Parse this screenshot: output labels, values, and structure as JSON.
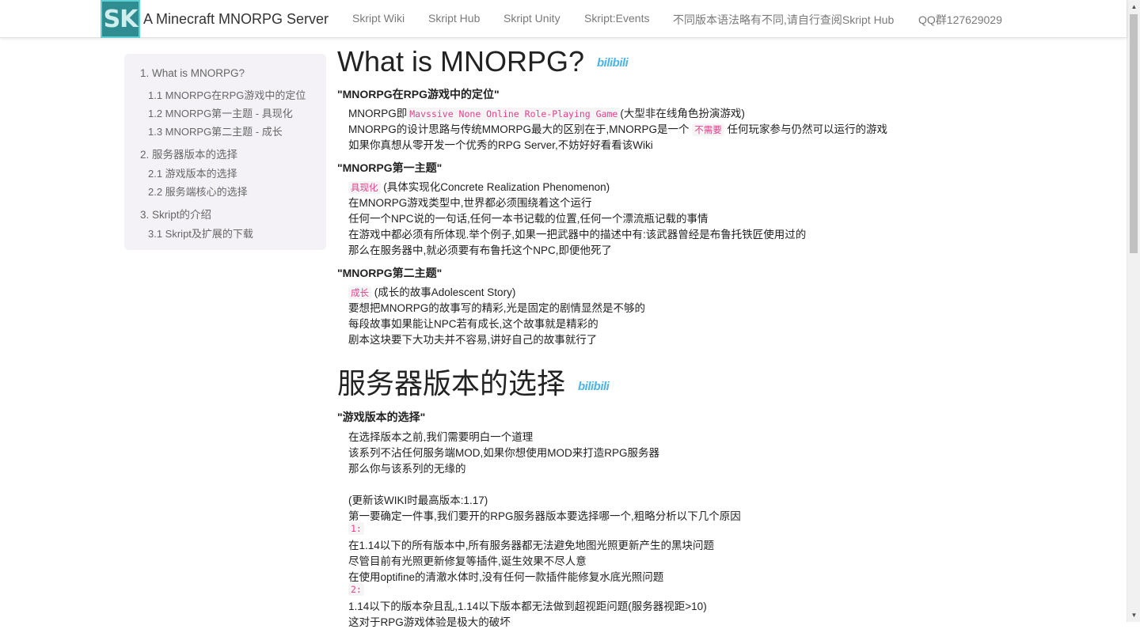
{
  "navbar": {
    "logo_text": "SK",
    "title": "A Minecraft MNORPG Server",
    "links": [
      "Skript Wiki",
      "Skript Hub",
      "Skript Unity",
      "Skript:Events",
      "不同版本语法略有不同,请自行查阅Skript Hub",
      "QQ群127629029"
    ]
  },
  "toc": {
    "items": [
      {
        "label": "1. What is MNORPG?"
      },
      {
        "label": "1.1 MNORPG在RPG游戏中的定位"
      },
      {
        "label": "1.2 MNORPG第一主题 - 具现化"
      },
      {
        "label": "1.3 MNORPG第二主题 - 成长"
      },
      {
        "label": "2. 服务器版本的选择"
      },
      {
        "label": "2.1 游戏版本的选择"
      },
      {
        "label": "2.2 服务端核心的选择"
      },
      {
        "label": "3. Skript的介绍"
      },
      {
        "label": "3.1 Skript及扩展的下载"
      }
    ]
  },
  "sections": {
    "s1": {
      "title": "What is MNORPG?",
      "bilibili": "bilibili",
      "sub1": {
        "heading": "\"MNORPG在RPG游戏中的定位\"",
        "l1_pre": "MNORPG即",
        "l1_code": "Mavssive None Online Role-Playing Game",
        "l1_post": "(大型非在线角色扮演游戏)",
        "l2_pre": "MNORPG的设计思路与传统MMORPG最大的区别在于,MNORPG是一个",
        "l2_code": "不需要",
        "l2_post": "任何玩家参与仍然可以运行的游戏",
        "l3": "如果你真想从零开发一个优秀的RPG Server,不妨好好看看该Wiki"
      },
      "sub2": {
        "heading": "\"MNORPG第一主题\"",
        "l1_code": "具现化",
        "l1_post": "(具体实现化Concrete Realization Phenomenon)",
        "l2": "在MNORPG游戏类型中,世界都必须围绕着这个运行",
        "l3": "任何一个NPC说的一句话,任何一本书记载的位置,任何一个漂流瓶记载的事情",
        "l4": "在游戏中都必须有所体现.举个例子,如果一把武器中的描述中有:该武器曾经是布鲁托铁匠使用过的",
        "l5": "那么在服务器中,就必须要有布鲁托这个NPC,即便他死了"
      },
      "sub3": {
        "heading": "\"MNORPG第二主题\"",
        "l1_code": "成长",
        "l1_post": "(成长的故事Adolescent Story)",
        "l2": "要想把MNORPG的故事写的精彩,光是固定的剧情显然是不够的",
        "l3": "每段故事如果能让NPC若有成长,这个故事就是精彩的",
        "l4": "剧本这块要下大功夫并不容易,讲好自己的故事就行了"
      }
    },
    "s2": {
      "title": "服务器版本的选择",
      "bilibili": "bilibili",
      "sub1": {
        "heading": "\"游戏版本的选择\"",
        "l1": "在选择版本之前,我们需要明白一个道理",
        "l2": "该系列不沾任何服务端MOD,如果你想使用MOD来打造RPG服务器",
        "l3": "那么你与该系列的无缘的",
        "l4": "(更新该WIKI时最高版本:1.17)",
        "l5": "第一要确定一件事,我们要开的RPG服务器版本要选择哪一个,粗略分析以下几个原因",
        "c1": "1:",
        "l6": "在1.14以下的所有版本中,所有服务器都无法避免地图光照更新产生的黑块问题",
        "l7": "尽管目前有光照更新修复等插件,诞生效果不尽人意",
        "l8": "在使用optifine的清澈水体时,没有任何一款插件能修复水底光照问题",
        "c2": "2:",
        "l9": "1.14以下的版本杂且乱,1.14以下版本都无法做到超视距问题(服务器视距>10)",
        "l10": "这对于RPG游戏体验是极大的破坏"
      }
    }
  }
}
